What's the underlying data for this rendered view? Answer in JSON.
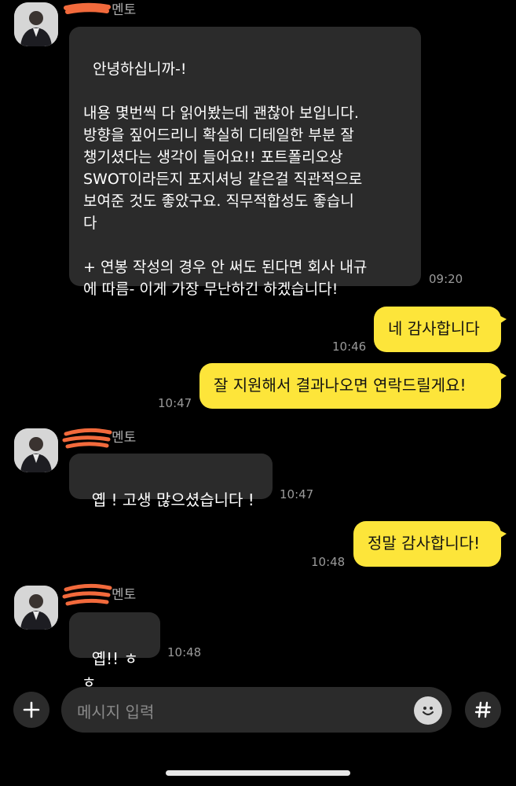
{
  "chat": {
    "sender_suffix": "멘토",
    "messages": [
      {
        "text": "안녕하십니까-!\n\n내용 몇번씩 다 읽어봤는데 괜찮아 보입니다.\n방향을 짚어드리니 확실히 디테일한 부분 잘\n챙기셨다는 생각이 들어요!! 포트폴리오상\nSWOT이라든지 포지셔닝 같은걸 직관적으로\n보여준 것도 좋았구요. 직무적합성도 좋습니\n다\n\n+ 연봉 작성의 경우 안 써도 된다면 회사 내규\n에 따름- 이게 가장 무난하긴 하겠습니다!",
        "time": "09:20"
      },
      {
        "text": "네 감사합니다",
        "time": "10:46"
      },
      {
        "text": "잘 지원해서 결과나오면 연락드릴게요!",
        "time": "10:47"
      },
      {
        "text": "옙 ! 고생 많으셨습니다 !",
        "time": "10:47"
      },
      {
        "text": "정말 감사합니다!",
        "time": "10:48"
      },
      {
        "text": "옙!! ㅎㅎ",
        "time": "10:48"
      }
    ]
  },
  "input": {
    "placeholder": "메시지 입력",
    "add_glyph": "+",
    "hash_glyph": "#"
  },
  "colors": {
    "background": "#000000",
    "incoming_bubble": "#2b2b2b",
    "outgoing_bubble": "#fde53a",
    "redaction_scribble": "#f26a3c"
  },
  "icons": [
    "avatar",
    "plus-icon",
    "emoji-icon",
    "hash-icon"
  ]
}
